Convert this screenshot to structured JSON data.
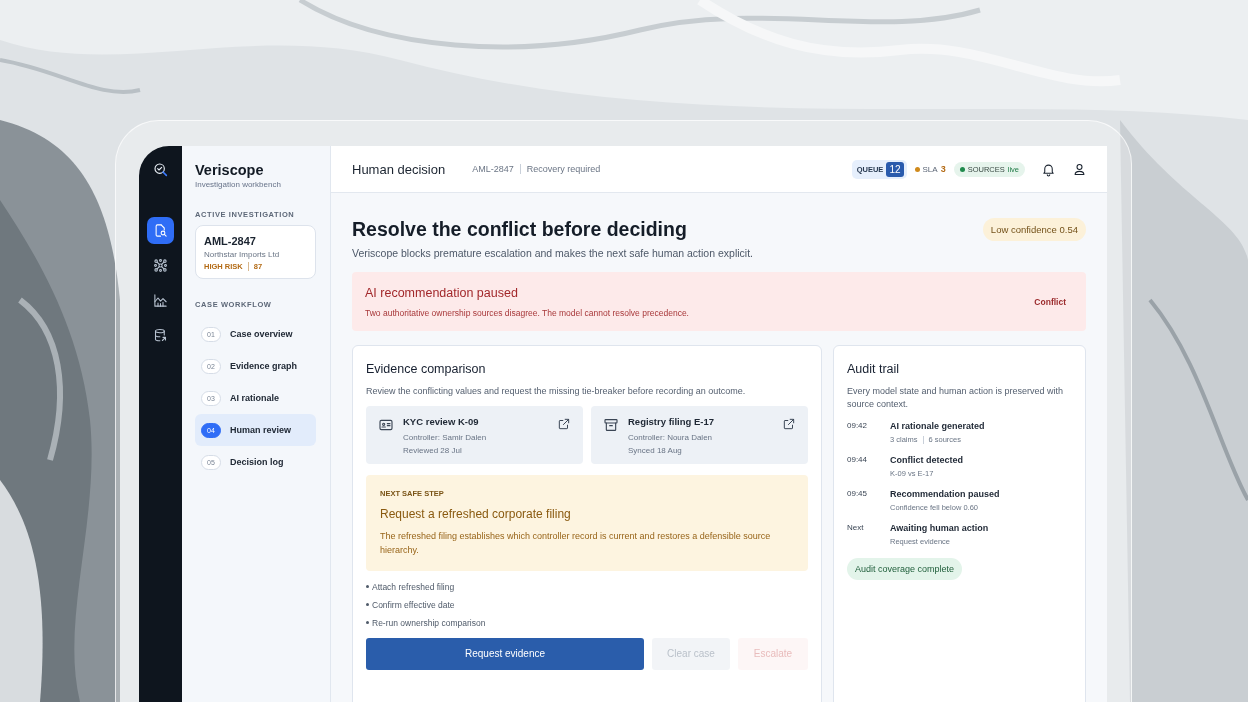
{
  "rail": [
    {
      "kind": "case",
      "selected": true
    },
    {
      "kind": "network",
      "selected": false
    },
    {
      "kind": "chart",
      "selected": false
    },
    {
      "kind": "database",
      "selected": false
    }
  ],
  "sidebar": {
    "brand": "Veriscope",
    "tagline": "Investigation workbench",
    "active_label": "ACTIVE INVESTIGATION",
    "case": {
      "id": "AML-2847",
      "company": "Northstar Imports Ltd",
      "risk": "HIGH RISK",
      "score": "87"
    },
    "workflow_label": "CASE WORKFLOW",
    "steps": [
      {
        "number": "01",
        "label": "Case overview",
        "selected": false
      },
      {
        "number": "02",
        "label": "Evidence graph",
        "selected": false
      },
      {
        "number": "03",
        "label": "AI rationale",
        "selected": false
      },
      {
        "number": "04",
        "label": "Human review",
        "selected": true
      },
      {
        "number": "05",
        "label": "Decision log",
        "selected": false
      }
    ]
  },
  "header": {
    "title": "Human decision",
    "case_id": "AML-2847",
    "status": "Recovery required",
    "queue": {
      "label": "QUEUE",
      "count": "12"
    },
    "sla": {
      "label": "SLA",
      "value": "3",
      "color": "#d08a1c"
    },
    "sources": {
      "label": "SOURCES",
      "value": "live",
      "color": "#1f8a4c"
    }
  },
  "main": {
    "title": "Resolve the conflict before deciding",
    "subtitle": "Veriscope blocks premature escalation and makes the next safe human action explicit.",
    "confidence": "Low confidence 0.54",
    "alert": {
      "title": "AI recommendation paused",
      "text": "Two authoritative ownership sources disagree. The model cannot resolve precedence.",
      "tag": "Conflict"
    },
    "evidence": {
      "title": "Evidence comparison",
      "description": "Review the conflicting values and request the missing tie-breaker before recording an outcome.",
      "sources": [
        {
          "kind": "id-card",
          "title": "KYC review K-09",
          "controller": "Controller: Samir Dalen",
          "date": "Reviewed 28 Jul"
        },
        {
          "kind": "archive",
          "title": "Registry filing E-17",
          "controller": "Controller: Noura Dalen",
          "date": "Synced 18 Aug"
        }
      ],
      "next_step": {
        "label": "NEXT SAFE STEP",
        "title": "Request a refreshed corporate filing",
        "text": "The refreshed filing establishes which controller record is current and restores a defensible source hierarchy."
      },
      "checklist": [
        "Attach refreshed filing",
        "Confirm effective date",
        "Re-run ownership comparison"
      ],
      "buttons": [
        {
          "label": "Request evidence",
          "kind": "primary",
          "disabled": false
        },
        {
          "label": "Clear case",
          "kind": "neutral",
          "disabled": true
        },
        {
          "label": "Escalate",
          "kind": "danger",
          "disabled": true
        }
      ]
    },
    "audit": {
      "title": "Audit trail",
      "description": "Every model state and human action is preserved with source context.",
      "events": [
        {
          "time": "09:42",
          "title": "AI rationale generated",
          "details": [
            "3 claims",
            "6 sources"
          ]
        },
        {
          "time": "09:44",
          "title": "Conflict detected",
          "details": [
            "K-09 vs E-17"
          ]
        },
        {
          "time": "09:45",
          "title": "Recommendation paused",
          "details": [
            "Confidence fell below 0.60"
          ]
        },
        {
          "time": "Next",
          "title": "Awaiting human action",
          "details": [
            "Request evidence"
          ]
        }
      ],
      "status": "Audit coverage complete"
    }
  }
}
